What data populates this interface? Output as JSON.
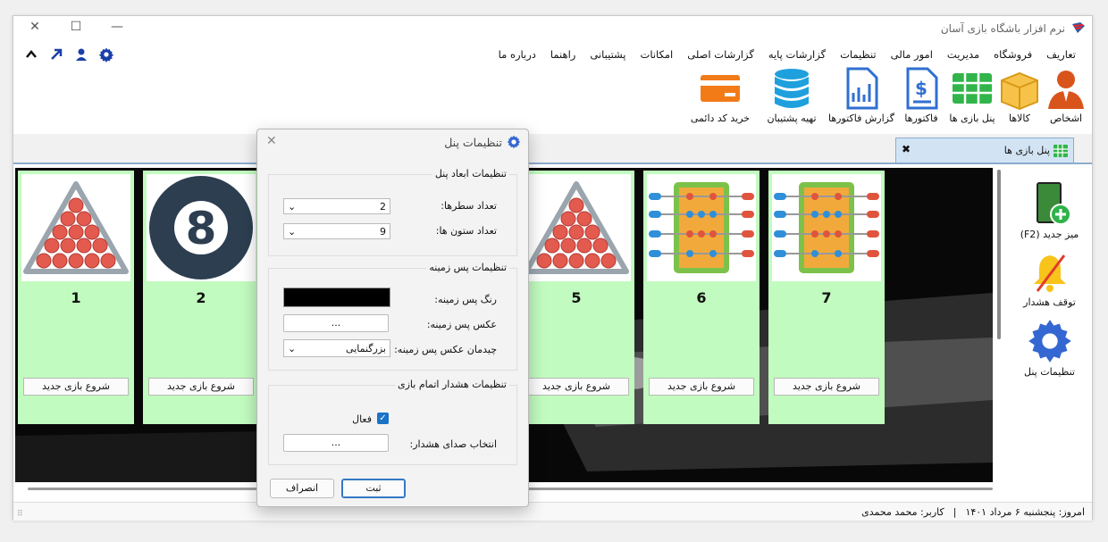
{
  "app": {
    "title": "نرم افزار باشگاه بازی آسان"
  },
  "window_controls": {
    "minimize": "—",
    "maximize": "☐",
    "close": "✕"
  },
  "menu": [
    "تعاریف",
    "فروشگاه",
    "مدیریت",
    "امور مالی",
    "تنظیمات",
    "گزارشات پایه",
    "گزارشات اصلی",
    "امکانات",
    "پشتیبانی",
    "راهنما",
    "درباره ما"
  ],
  "quick_icons": [
    "chevron-up-icon",
    "arrow-up-right-icon",
    "user-icon",
    "gear-icon"
  ],
  "ribbon": [
    {
      "label": "اشخاص",
      "icon": "person-icon"
    },
    {
      "label": "کالاها",
      "icon": "box-icon"
    },
    {
      "label": "پنل بازی ها",
      "icon": "grid-icon"
    },
    {
      "label": "فاکتورها",
      "icon": "invoice-icon"
    },
    {
      "label": "گزارش فاکتورها",
      "icon": "report-icon"
    },
    {
      "label": "تهیه پشتیبان",
      "icon": "database-icon"
    },
    {
      "label": "خرید کد دائمی",
      "icon": "credit-card-icon"
    }
  ],
  "tab": {
    "label": "پنل بازی ها",
    "close": "✖"
  },
  "cards": [
    {
      "num": "1",
      "img": "snooker-triangle-icon",
      "start": "شروع بازی جدید"
    },
    {
      "num": "2",
      "img": "eight-ball-icon",
      "start": "شروع بازی جدید"
    },
    {
      "num": "5",
      "img": "snooker-triangle-icon",
      "start": "شروع بازی جدید"
    },
    {
      "num": "6",
      "img": "foosball-table-icon",
      "start": "شروع بازی جدید"
    },
    {
      "num": "7",
      "img": "foosball-table-icon",
      "start": "شروع بازی جدید"
    }
  ],
  "sidebar": [
    {
      "label": "میز جدید (F2)",
      "icon": "add-table-icon"
    },
    {
      "label": "توقف هشدار",
      "icon": "bell-off-icon"
    },
    {
      "label": "تنظیمات پنل",
      "icon": "gear-icon"
    }
  ],
  "status": {
    "date": "امروز: پنجشنبه ۶ مرداد ۱۴۰۱",
    "sep": "|",
    "user": "کاربر: محمد محمدی"
  },
  "dialog": {
    "title": "تنظیمات پنل",
    "group1": {
      "title": "تنظیمات ابعاد پنل",
      "rows_label": "تعداد سطرها:",
      "rows_value": "2",
      "cols_label": "تعداد ستون ها:",
      "cols_value": "9"
    },
    "group2": {
      "title": "تنظیمات پس زمینه",
      "color_label": "رنگ پس زمینه:",
      "color_value": "#000000",
      "image_label": "عکس پس زمینه:",
      "image_button": "...",
      "layout_label": "چیدمان عکس پس زمینه:",
      "layout_value": "بزرگنمایی"
    },
    "group3": {
      "title": "تنظیمات هشدار اتمام بازی",
      "active_label": "فعال",
      "active_checked": true,
      "sound_label": "انتخاب صدای هشدار:",
      "sound_button": "..."
    },
    "ok": "ثبت",
    "cancel": "انصراف"
  }
}
